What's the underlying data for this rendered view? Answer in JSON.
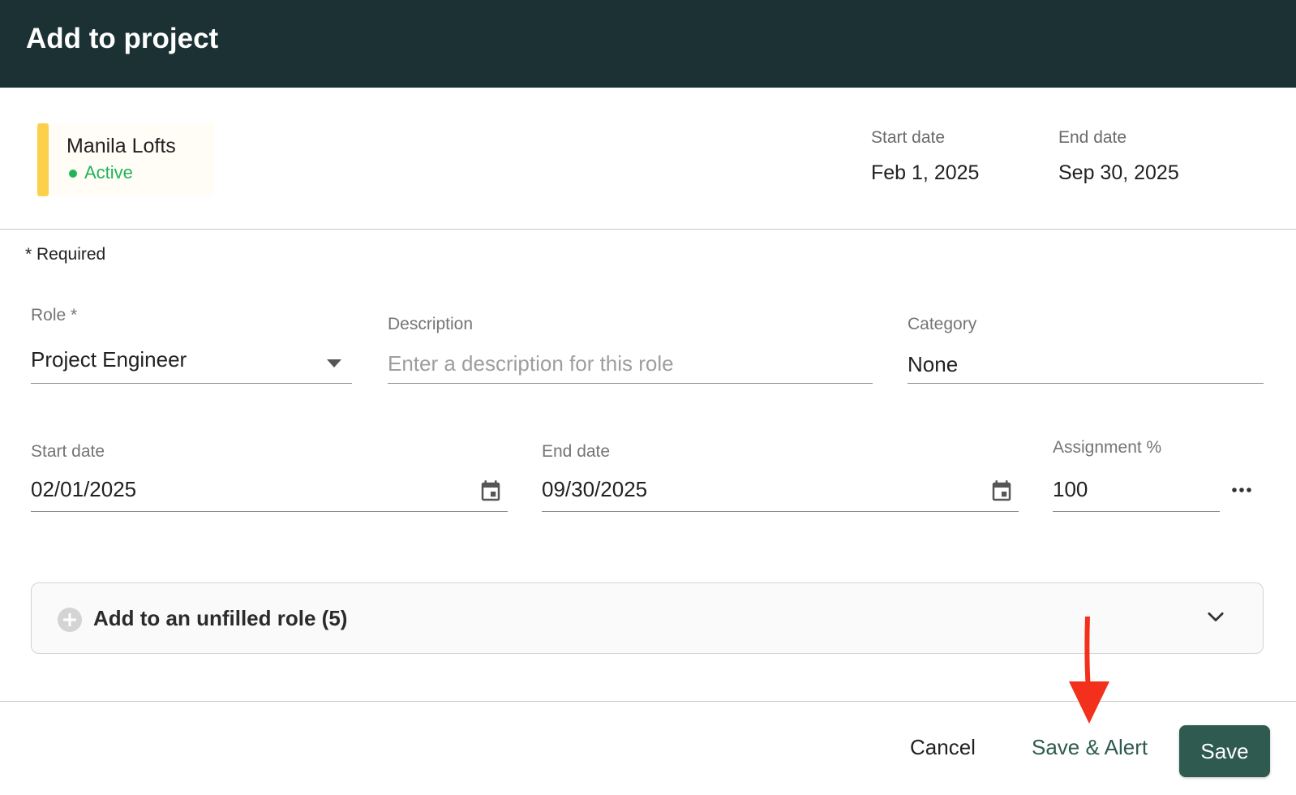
{
  "dialog": {
    "title": "Add to project"
  },
  "project": {
    "name": "Manila Lofts",
    "status": "Active",
    "start_date_label": "Start date",
    "start_date": "Feb 1, 2025",
    "end_date_label": "End date",
    "end_date": "Sep 30, 2025"
  },
  "form": {
    "required_note": "* Required",
    "role": {
      "label": "Role *",
      "value": "Project Engineer"
    },
    "description": {
      "label": "Description",
      "placeholder": "Enter a description for this role",
      "value": ""
    },
    "category": {
      "label": "Category",
      "value": "None"
    },
    "start_date": {
      "label": "Start date",
      "value": "02/01/2025"
    },
    "end_date": {
      "label": "End date",
      "value": "09/30/2025"
    },
    "assignment": {
      "label": "Assignment %",
      "value": "100"
    }
  },
  "unfilled_role": {
    "label": "Add to an unfilled role (5)"
  },
  "footer": {
    "cancel_label": "Cancel",
    "save_alert_label": "Save & Alert",
    "save_label": "Save"
  },
  "icons": {
    "calendar": "calendar-icon",
    "more": "more-horizontal-icon",
    "dropdown": "dropdown-triangle-icon",
    "chevron": "chevron-down-icon",
    "plus": "plus-circle-icon"
  },
  "colors": {
    "header_bg": "#1b3133",
    "accent_yellow": "#fbd04b",
    "status_green": "#20b45a",
    "primary_button": "#2e5a4f",
    "annotation_arrow": "#f2301c"
  }
}
